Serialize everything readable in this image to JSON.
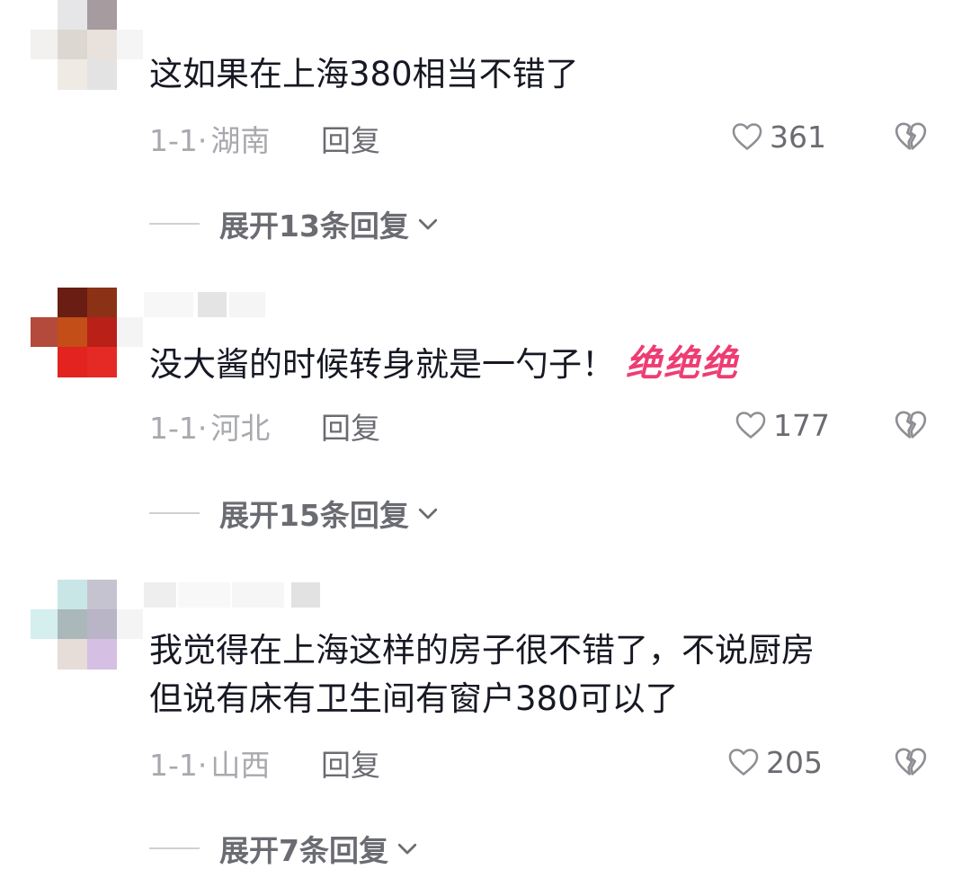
{
  "comments": [
    {
      "text": "这如果在上海380相当不错了",
      "sticker": "",
      "date": "1-1·",
      "region": "湖南",
      "reply_label": "回复",
      "likes": "361",
      "expand_label": "展开13条回复"
    },
    {
      "text": "没大酱的时候转身就是一勺子！",
      "sticker": "绝绝绝",
      "date": "1-1·",
      "region": "河北",
      "reply_label": "回复",
      "likes": "177",
      "expand_label": "展开15条回复"
    },
    {
      "text_line1": "我觉得在上海这样的房子很不错了，不说厨房",
      "text_line2": "但说有床有卫生间有窗户380可以了",
      "date": "1-1·",
      "region": "山西",
      "reply_label": "回复",
      "likes": "205",
      "expand_label": "展开7条回复"
    }
  ],
  "icons": {
    "like": "heart-outline-icon",
    "dislike": "broken-heart-icon",
    "expand": "chevron-down-icon"
  },
  "colors": {
    "primary_text": "#161823",
    "secondary_text": "#a8a9ae",
    "action_text": "#6b6c72",
    "sticker": "#ee3d73"
  }
}
